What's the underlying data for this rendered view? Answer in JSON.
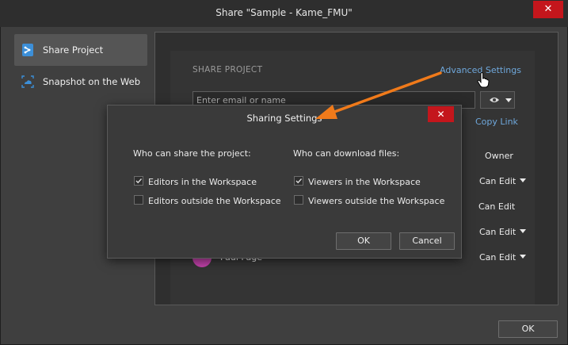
{
  "window": {
    "title": "Share \"Sample - Kame_FMU\"",
    "close_label": "✕"
  },
  "sidebar": {
    "items": [
      {
        "label": "Share Project",
        "icon": "share-project-icon"
      },
      {
        "label": "Snapshot on the Web",
        "icon": "web-snapshot-icon"
      }
    ]
  },
  "share": {
    "heading": "SHARE PROJECT",
    "advanced_settings": "Advanced Settings",
    "email_placeholder": "Enter email or name",
    "copy_link": "Copy Link",
    "roles": [
      "Owner",
      "Can Edit",
      "Can Edit",
      "Can Edit",
      "Can Edit"
    ],
    "person_visible": "Paul Page"
  },
  "dialog": {
    "title": "Sharing Settings",
    "close_label": "✕",
    "left_heading": "Who can share the project:",
    "right_heading": "Who can download files:",
    "left_options": [
      {
        "label": "Editors in the Workspace",
        "checked": true
      },
      {
        "label": "Editors outside the Workspace",
        "checked": false
      }
    ],
    "right_options": [
      {
        "label": "Viewers in the Workspace",
        "checked": true
      },
      {
        "label": "Viewers outside the Workspace",
        "checked": false
      }
    ],
    "ok_label": "OK",
    "cancel_label": "Cancel"
  },
  "footer": {
    "ok_label": "OK"
  },
  "colors": {
    "accent": "#6fa8dc",
    "close_red": "#c4161c",
    "arrow": "#f07a1a"
  }
}
